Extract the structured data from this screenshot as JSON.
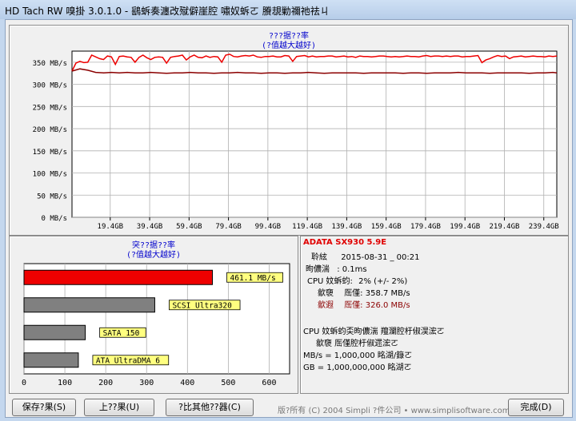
{
  "window": {
    "title": "HD Tach RW 嗅掛 3.0.1.0 - 鷂蚸奏瀍改殧僻崖腔   嘯奴蚸ㄛ   賸覟勦禰祂祛ㄐ"
  },
  "colors": {
    "read": "#ee0000",
    "read_dark": "#8b0000",
    "bar_gray": "#808080",
    "label_bg": "#ffff80",
    "plot_bg": "#ffffff",
    "grid": "#b0b0b0"
  },
  "top_chart": {
    "title": "???据??率",
    "subtitle": "(?值越大越好)"
  },
  "bar_panel": {
    "title": "突??据??率",
    "subtitle": "(?值越大越好)"
  },
  "chart_data": [
    {
      "type": "line",
      "title": "???据??率",
      "subtitle": "(?值越大越好)",
      "ylabel": "",
      "xlabel": "",
      "ylim": [
        0,
        375
      ],
      "xlim": [
        0,
        246
      ],
      "y_ticks": [
        0,
        50,
        100,
        150,
        200,
        250,
        300,
        350
      ],
      "y_tick_labels": [
        "0 MB/s",
        "50 MB/s",
        "100 MB/s",
        "150 MB/s",
        "200 MB/s",
        "250 MB/s",
        "300 MB/s",
        "350 MB/s"
      ],
      "x_ticks": [
        19.4,
        39.4,
        59.4,
        79.4,
        99.4,
        119.4,
        139.4,
        159.4,
        179.4,
        199.4,
        219.4,
        239.4
      ],
      "x_tick_labels": [
        "19.4GB",
        "39.4GB",
        "59.4GB",
        "79.4GB",
        "99.4GB",
        "119.4GB",
        "139.4GB",
        "159.4GB",
        "179.4GB",
        "199.4GB",
        "219.4GB",
        "239.4GB"
      ],
      "grid": true,
      "series": [
        {
          "color": "#ee0000",
          "x": [
            0,
            2,
            4,
            6,
            8,
            10,
            12,
            14,
            16,
            18,
            20,
            22,
            24,
            26,
            28,
            30,
            32,
            34,
            36,
            38,
            40,
            42,
            44,
            46,
            48,
            50,
            52,
            54,
            56,
            58,
            60,
            62,
            64,
            66,
            68,
            70,
            72,
            74,
            76,
            78,
            80,
            82,
            84,
            86,
            88,
            90,
            92,
            94,
            96,
            98,
            100,
            102,
            104,
            106,
            108,
            110,
            112,
            114,
            116,
            118,
            120,
            122,
            124,
            126,
            128,
            130,
            132,
            134,
            136,
            138,
            140,
            142,
            144,
            146,
            148,
            150,
            152,
            154,
            156,
            158,
            160,
            162,
            164,
            166,
            168,
            170,
            172,
            174,
            176,
            178,
            180,
            182,
            184,
            186,
            188,
            190,
            192,
            194,
            196,
            198,
            200,
            202,
            204,
            206,
            208,
            210,
            212,
            214,
            216,
            218,
            220,
            222,
            224,
            226,
            228,
            230,
            232,
            234,
            236,
            238,
            240,
            242,
            244,
            246
          ],
          "y": [
            330,
            348,
            352,
            349,
            350,
            366,
            362,
            358,
            356,
            364,
            362,
            345,
            363,
            364,
            362,
            361,
            350,
            361,
            366,
            360,
            356,
            361,
            362,
            361,
            348,
            361,
            363,
            364,
            366,
            355,
            362,
            366,
            361,
            360,
            364,
            361,
            363,
            362,
            350,
            366,
            368,
            363,
            362,
            364,
            365,
            364,
            366,
            362,
            361,
            363,
            363,
            364,
            362,
            362,
            365,
            364,
            352,
            363,
            364,
            365,
            362,
            364,
            362,
            363,
            363,
            364,
            364,
            362,
            363,
            364,
            362,
            363,
            361,
            364,
            363,
            363,
            362,
            363,
            364,
            364,
            363,
            362,
            363,
            362,
            363,
            364,
            363,
            363,
            362,
            364,
            365,
            363,
            364,
            364,
            363,
            364,
            363,
            364,
            364,
            362,
            363,
            363,
            364,
            365,
            349,
            355,
            358,
            362,
            365,
            363,
            364,
            358,
            362,
            363,
            364,
            362,
            363,
            364,
            363,
            363,
            362,
            364,
            363,
            364
          ]
        },
        {
          "color": "#8b0000",
          "x": [
            0,
            4,
            8,
            12,
            16,
            20,
            24,
            28,
            32,
            36,
            40,
            44,
            48,
            52,
            56,
            60,
            64,
            68,
            72,
            76,
            80,
            84,
            88,
            92,
            96,
            100,
            104,
            108,
            112,
            116,
            120,
            124,
            128,
            132,
            136,
            140,
            144,
            148,
            152,
            156,
            160,
            164,
            168,
            172,
            176,
            180,
            184,
            188,
            192,
            196,
            200,
            204,
            208,
            212,
            216,
            220,
            224,
            228,
            232,
            236,
            240,
            244,
            246
          ],
          "y": [
            330,
            335,
            332,
            327,
            326,
            327,
            326,
            327,
            326,
            326,
            327,
            326,
            325,
            326,
            326,
            327,
            326,
            326,
            325,
            326,
            326,
            327,
            326,
            326,
            325,
            326,
            326,
            325,
            326,
            326,
            327,
            326,
            325,
            326,
            326,
            326,
            326,
            325,
            326,
            326,
            326,
            326,
            325,
            326,
            326,
            325,
            326,
            326,
            326,
            327,
            326,
            326,
            326,
            325,
            326,
            326,
            326,
            326,
            325,
            326,
            326,
            327,
            326
          ]
        }
      ]
    },
    {
      "type": "bar",
      "orientation": "horizontal",
      "title": "突??据??率",
      "subtitle": "(?值越大越好)",
      "xlim": [
        0,
        650
      ],
      "x_ticks": [
        0,
        100,
        200,
        300,
        400,
        500,
        600
      ],
      "x_tick_labels": [
        "0",
        "100",
        "200",
        "300",
        "400",
        "500",
        "600"
      ],
      "categories": [
        "461.1 MB/s",
        "SCSI Ultra320",
        "SATA 150",
        "ATA UltraDMA 6"
      ],
      "values": [
        461.1,
        320,
        150,
        133
      ],
      "colors": [
        "#ee0000",
        "#808080",
        "#808080",
        "#808080"
      ],
      "grid": true
    }
  ],
  "info": {
    "drive_name": "ADATA SX930 5.9E",
    "date_label": "聆絃",
    "date_value": "2015-08-31 _ 00:21",
    "access_label": "昫儂湍",
    "access_value": ": 0.1ms",
    "cpu_label": "CPU 妏蚸蚐:",
    "cpu_value": "2% (+/- 2%)",
    "read_label": "歙褏",
    "read_value": "厒僅: 358.7 MB/s",
    "write_label": "歙遐",
    "write_value": "厒僅: 326.0 MB/s",
    "note1": "CPU 妏蚸蚐奀昫儂湍   羶瀾腔杅俶淏浤ㄛ",
    "note2": "歙褏   厒僅腔杅俶遝浤ㄛ",
    "note3": "MB/s = 1,000,000 眳湖/籙ㄛ",
    "note4": "GB = 1,000,000,000 眳湖ㄛ"
  },
  "footer": {
    "save_button": "保存?果(S)",
    "upload_button": "上??果(U)",
    "compare_button": "?比其他??器(C)",
    "copyright": "版?所有 (C) 2004 Simpli ?件公司 • www.simplisoftware.com",
    "done_button": "完成(D)"
  }
}
